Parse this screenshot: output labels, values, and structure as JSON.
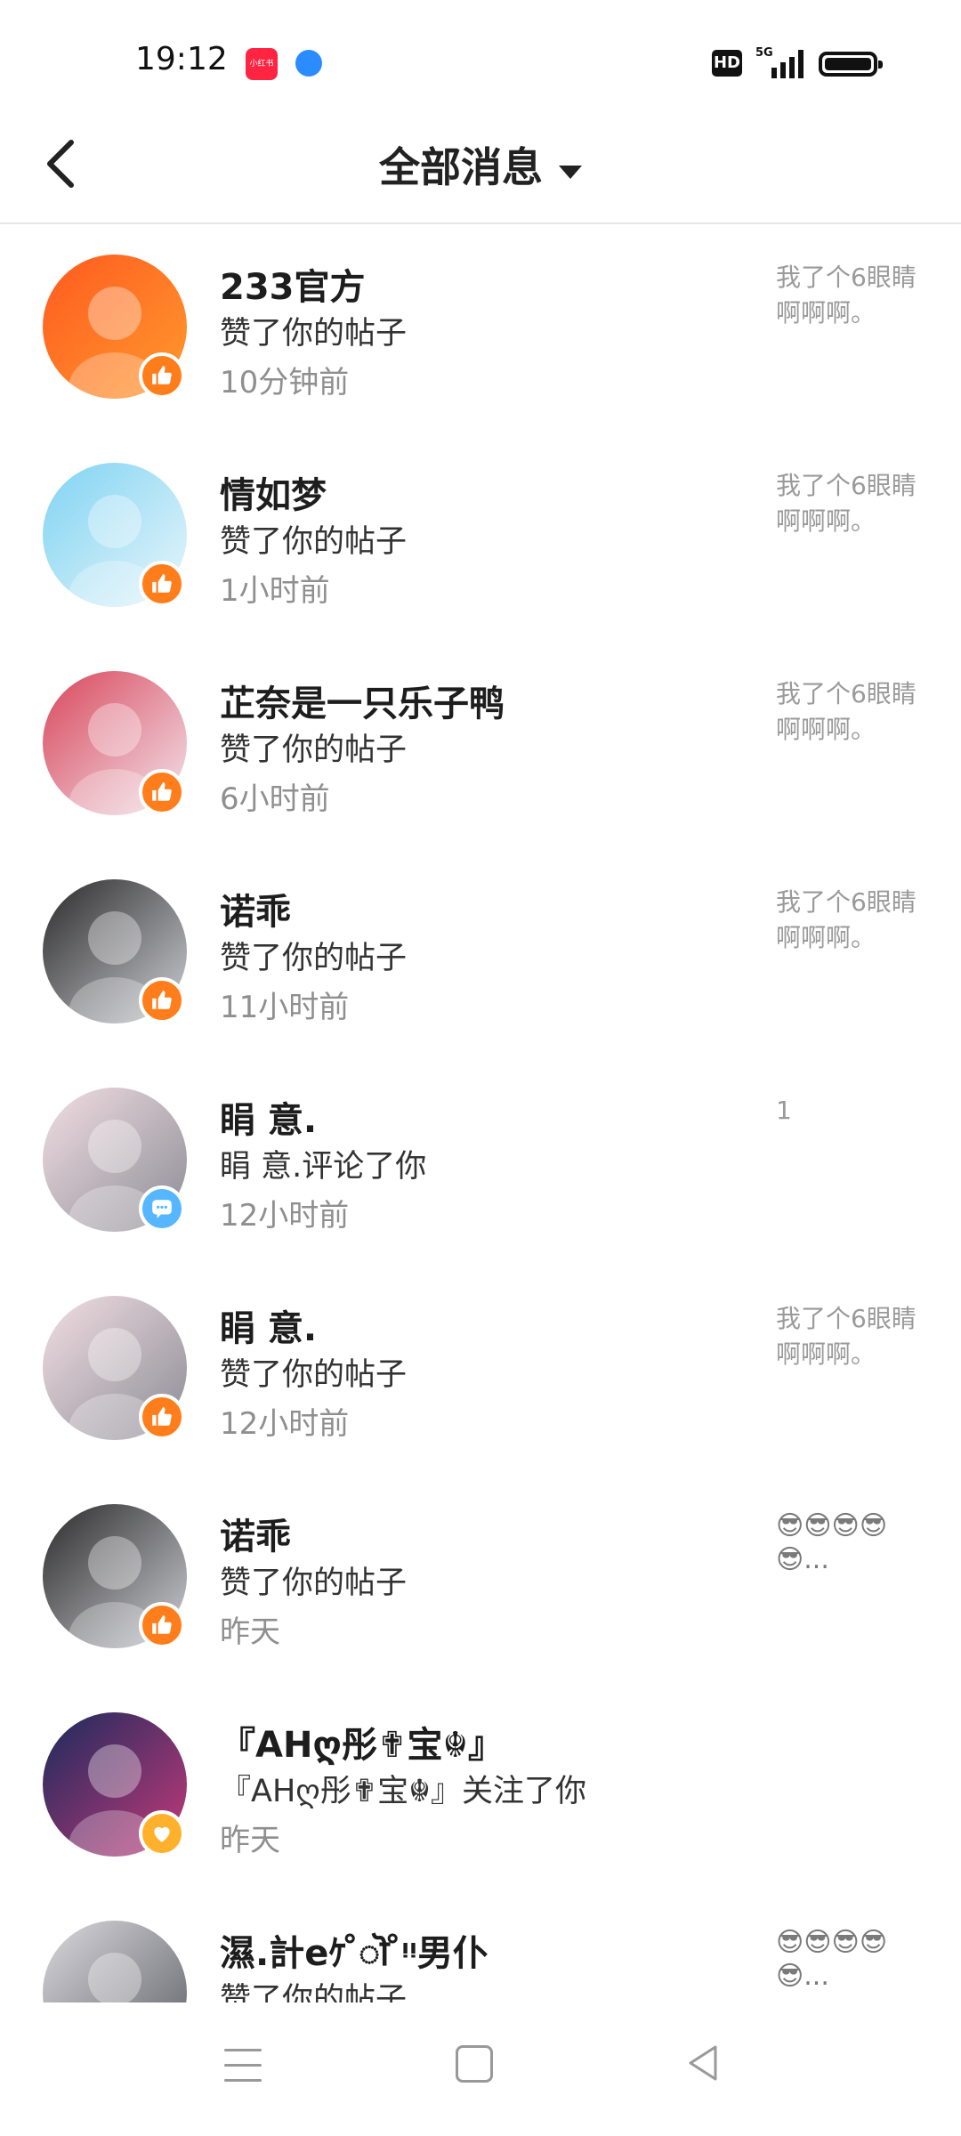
{
  "status_bar": {
    "time": "19:12",
    "app1_label": "小红书",
    "hd": "HD",
    "network": "5G"
  },
  "header": {
    "title": "全部消息"
  },
  "messages": [
    {
      "name": "233官方",
      "action": "赞了你的帖子",
      "time": "10分钟前",
      "snippet": "我了个6眼睛啊啊啊。",
      "badge": "like",
      "avatar_colors": [
        "#ff5a1f",
        "#ff9a2e"
      ]
    },
    {
      "name": "情如梦",
      "action": "赞了你的帖子",
      "time": "1小时前",
      "snippet": "我了个6眼睛啊啊啊。",
      "badge": "like",
      "avatar_colors": [
        "#7fd3f2",
        "#e9f6fb"
      ]
    },
    {
      "name": "芷奈是一只乐子鸭",
      "action": "赞了你的帖子",
      "time": "6小时前",
      "snippet": "我了个6眼睛啊啊啊。",
      "badge": "like",
      "avatar_colors": [
        "#d8465a",
        "#f3e6ee"
      ]
    },
    {
      "name": "诺乖",
      "action": "赞了你的帖子",
      "time": "11小时前",
      "snippet": "我了个6眼睛啊啊啊。",
      "badge": "like",
      "avatar_colors": [
        "#2a2a2a",
        "#cfd0d6"
      ]
    },
    {
      "name": "睊  意.",
      "action": "睊  意.评论了你",
      "time": "12小时前",
      "snippet": "1",
      "badge": "comment",
      "avatar_colors": [
        "#f2dfe3",
        "#8b8b95"
      ]
    },
    {
      "name": "睊  意.",
      "action": "赞了你的帖子",
      "time": "12小时前",
      "snippet": "我了个6眼睛啊啊啊。",
      "badge": "like",
      "avatar_colors": [
        "#f2dfe3",
        "#8b8b95"
      ]
    },
    {
      "name": "诺乖",
      "action": "赞了你的帖子",
      "time": "昨天",
      "snippet": "😎😎😎😎😎...",
      "badge": "like",
      "avatar_colors": [
        "#2a2a2a",
        "#cfd0d6"
      ]
    },
    {
      "name": "『AHღ彤✟宝☬』",
      "action": "『AHღ彤✟宝☬』关注了你",
      "time": "昨天",
      "snippet": "",
      "badge": "follow",
      "avatar_colors": [
        "#1b2a5c",
        "#c43a7a"
      ]
    },
    {
      "name": "濕.計eｹ ̊ॊ ̊ᵎᵎ男仆",
      "action": "赞了你的帖子",
      "time": "",
      "snippet": "😎😎😎😎😎...",
      "badge": "like",
      "avatar_colors": [
        "#d9d9de",
        "#5e5e66"
      ]
    }
  ],
  "icons": {
    "back": "back-arrow-icon",
    "dropdown": "caret-down-icon",
    "like": "thumbs-up-icon",
    "comment": "comment-bubble-icon",
    "follow": "heart-icon"
  },
  "colors": {
    "like_badge": "#ff7d1a",
    "comment_badge": "#56b6ff",
    "follow_badge": "#ffb12b"
  }
}
